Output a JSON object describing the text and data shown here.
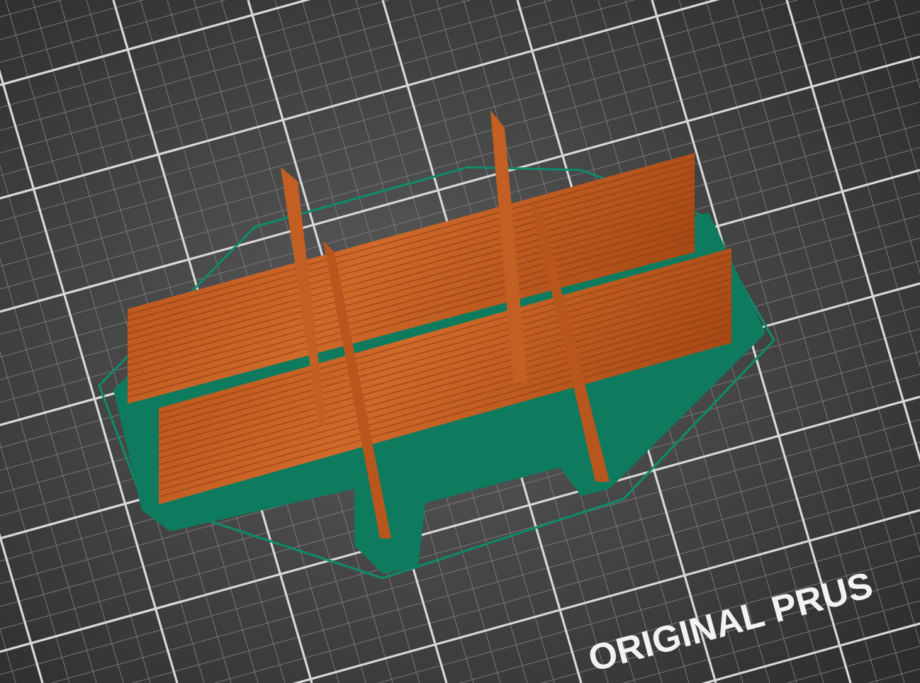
{
  "bed_label": "ORIGINAL PRUS"
}
